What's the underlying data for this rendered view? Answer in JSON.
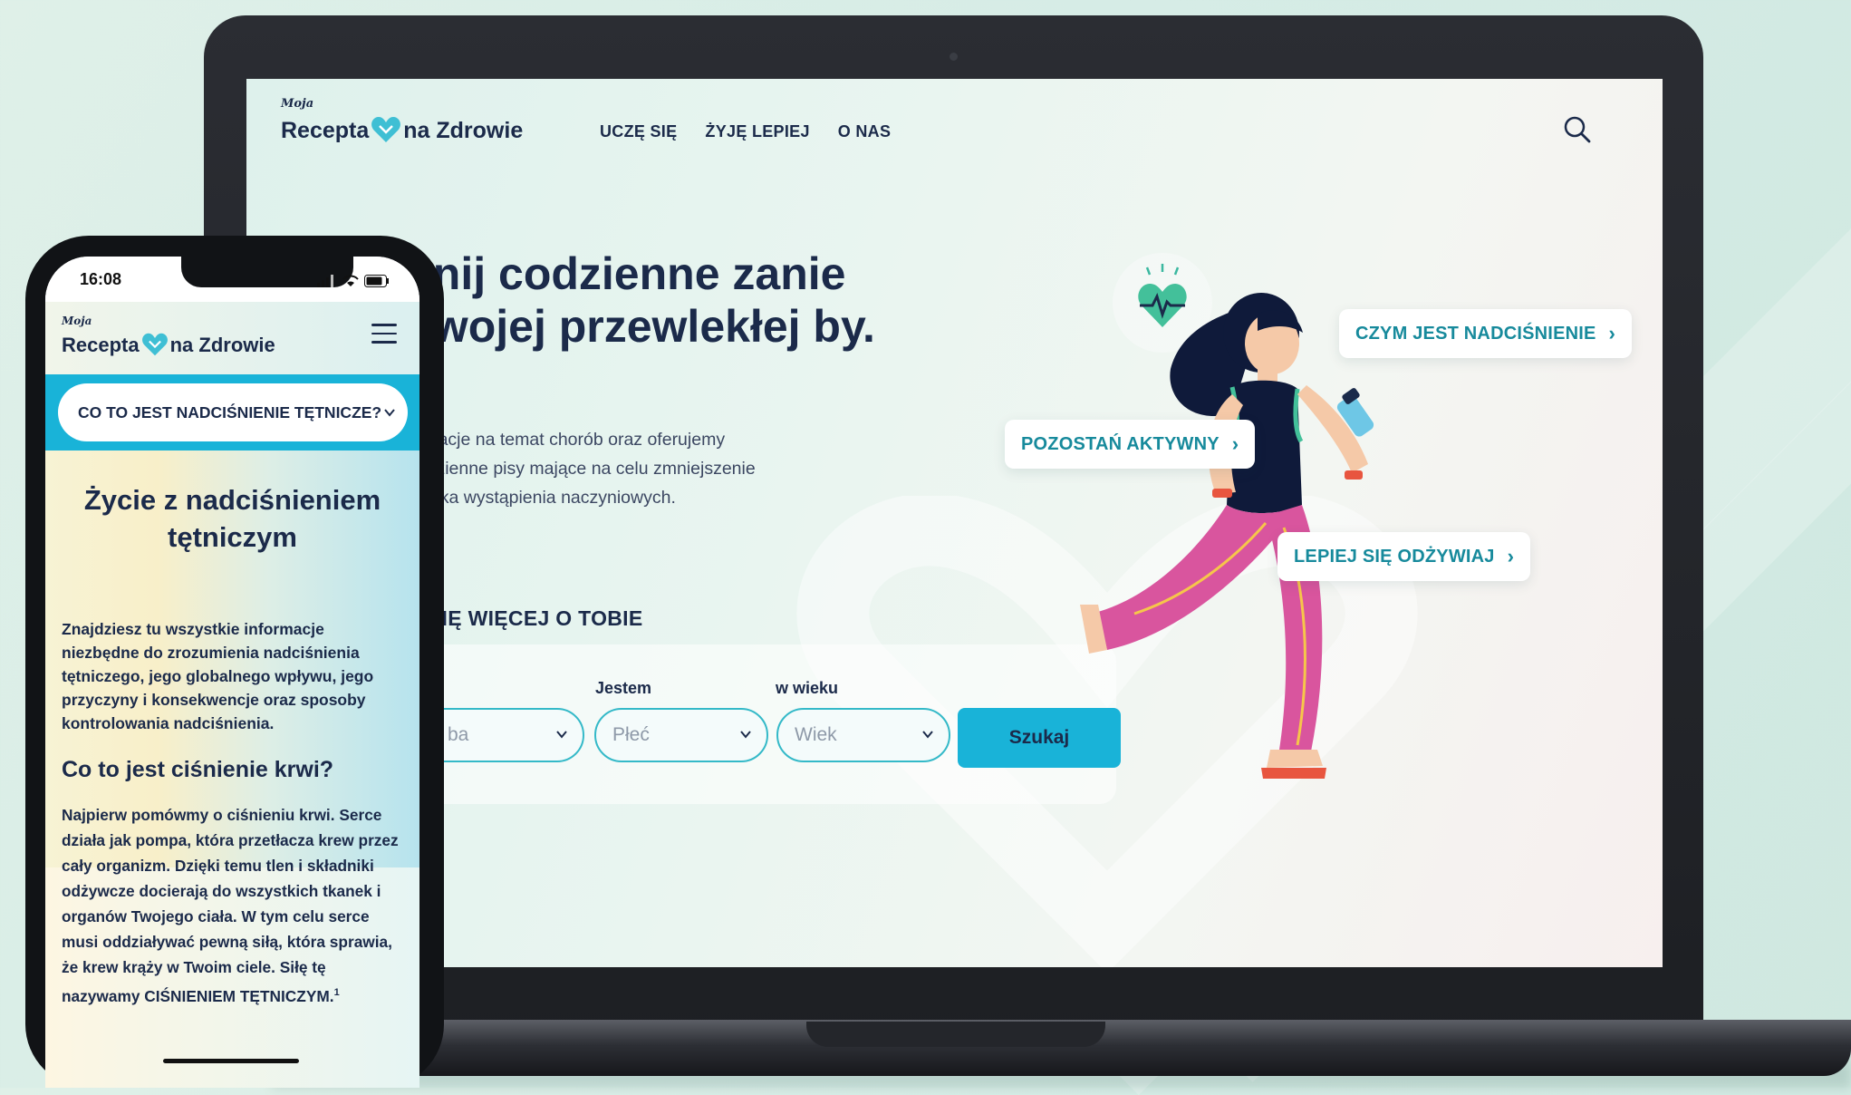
{
  "desktop": {
    "logo": {
      "moja": "Moja",
      "recepta": "Recepta",
      "na_zdrowie": "na Zdrowie"
    },
    "nav": [
      "UCZĘ SIĘ",
      "ŻYJĘ LEPIEJ",
      "O NAS"
    ],
    "hero": {
      "title": "cnij codzienne zanie swojej przewlekłej by.",
      "text": "ormacje na temat chorób oraz oferujemy codzienne pisy mające na celu zmniejszenie ryzyka wystąpienia naczyniowych."
    },
    "section_title": "Y SIĘ WIĘCEJ O TOBIE",
    "form": {
      "label_gender": "Jestem",
      "label_age": "w wieku",
      "select_first_value": "ba",
      "select_gender_placeholder": "Płeć",
      "select_age_placeholder": "Wiek",
      "search_button": "Szukaj"
    },
    "bubbles": {
      "hypertension": "CZYM JEST NADCIŚNIENIE",
      "active": "POZOSTAŃ AKTYWNY",
      "nutrition": "LEPIEJ SIĘ ODŻYWIAJ"
    },
    "icons": [
      "search-icon",
      "heart-pulse-icon",
      "chevron-down-icon",
      "chevron-right-icon"
    ]
  },
  "phone": {
    "time": "16:08",
    "logo": {
      "moja": "Moja",
      "recepta": "Recepta",
      "na_zdrowie": "na Zdrowie"
    },
    "dropdown": "CO TO JEST NADCIŚNIENIE TĘTNICZE?",
    "title": "Życie z nadciśnieniem tętniczym",
    "intro": "Znajdziesz tu wszystkie informacje niezbędne do zrozumienia nadciśnienia tętniczego, jego globalnego wpływu, jego przyczyny i konsekwencje oraz sposoby kontrolowania nadciśnienia.",
    "h2": "Co to jest ciśnienie krwi?",
    "paragraph": "Najpierw pomówmy o ciśnieniu krwi. Serce działa jak pompa, która przetłacza krew przez cały organizm. Dzięki temu tlen i składniki odżywcze docierają do wszystkich tkanek i organów Twojego ciała. W tym celu serce musi oddziaływać pewną siłą, która sprawia, że krew krąży w Twoim ciele. Siłę tę nazywamy CIŚNIENIEM TĘTNICZYM.",
    "footnote": "1",
    "icons": [
      "menu-icon",
      "signal-icon",
      "wifi-icon",
      "battery-icon",
      "chevron-down-icon"
    ]
  },
  "colors": {
    "navy": "#1b2a4a",
    "teal": "#19b3d8",
    "accent_teal": "#178a9c",
    "pink": "#d9559e"
  }
}
